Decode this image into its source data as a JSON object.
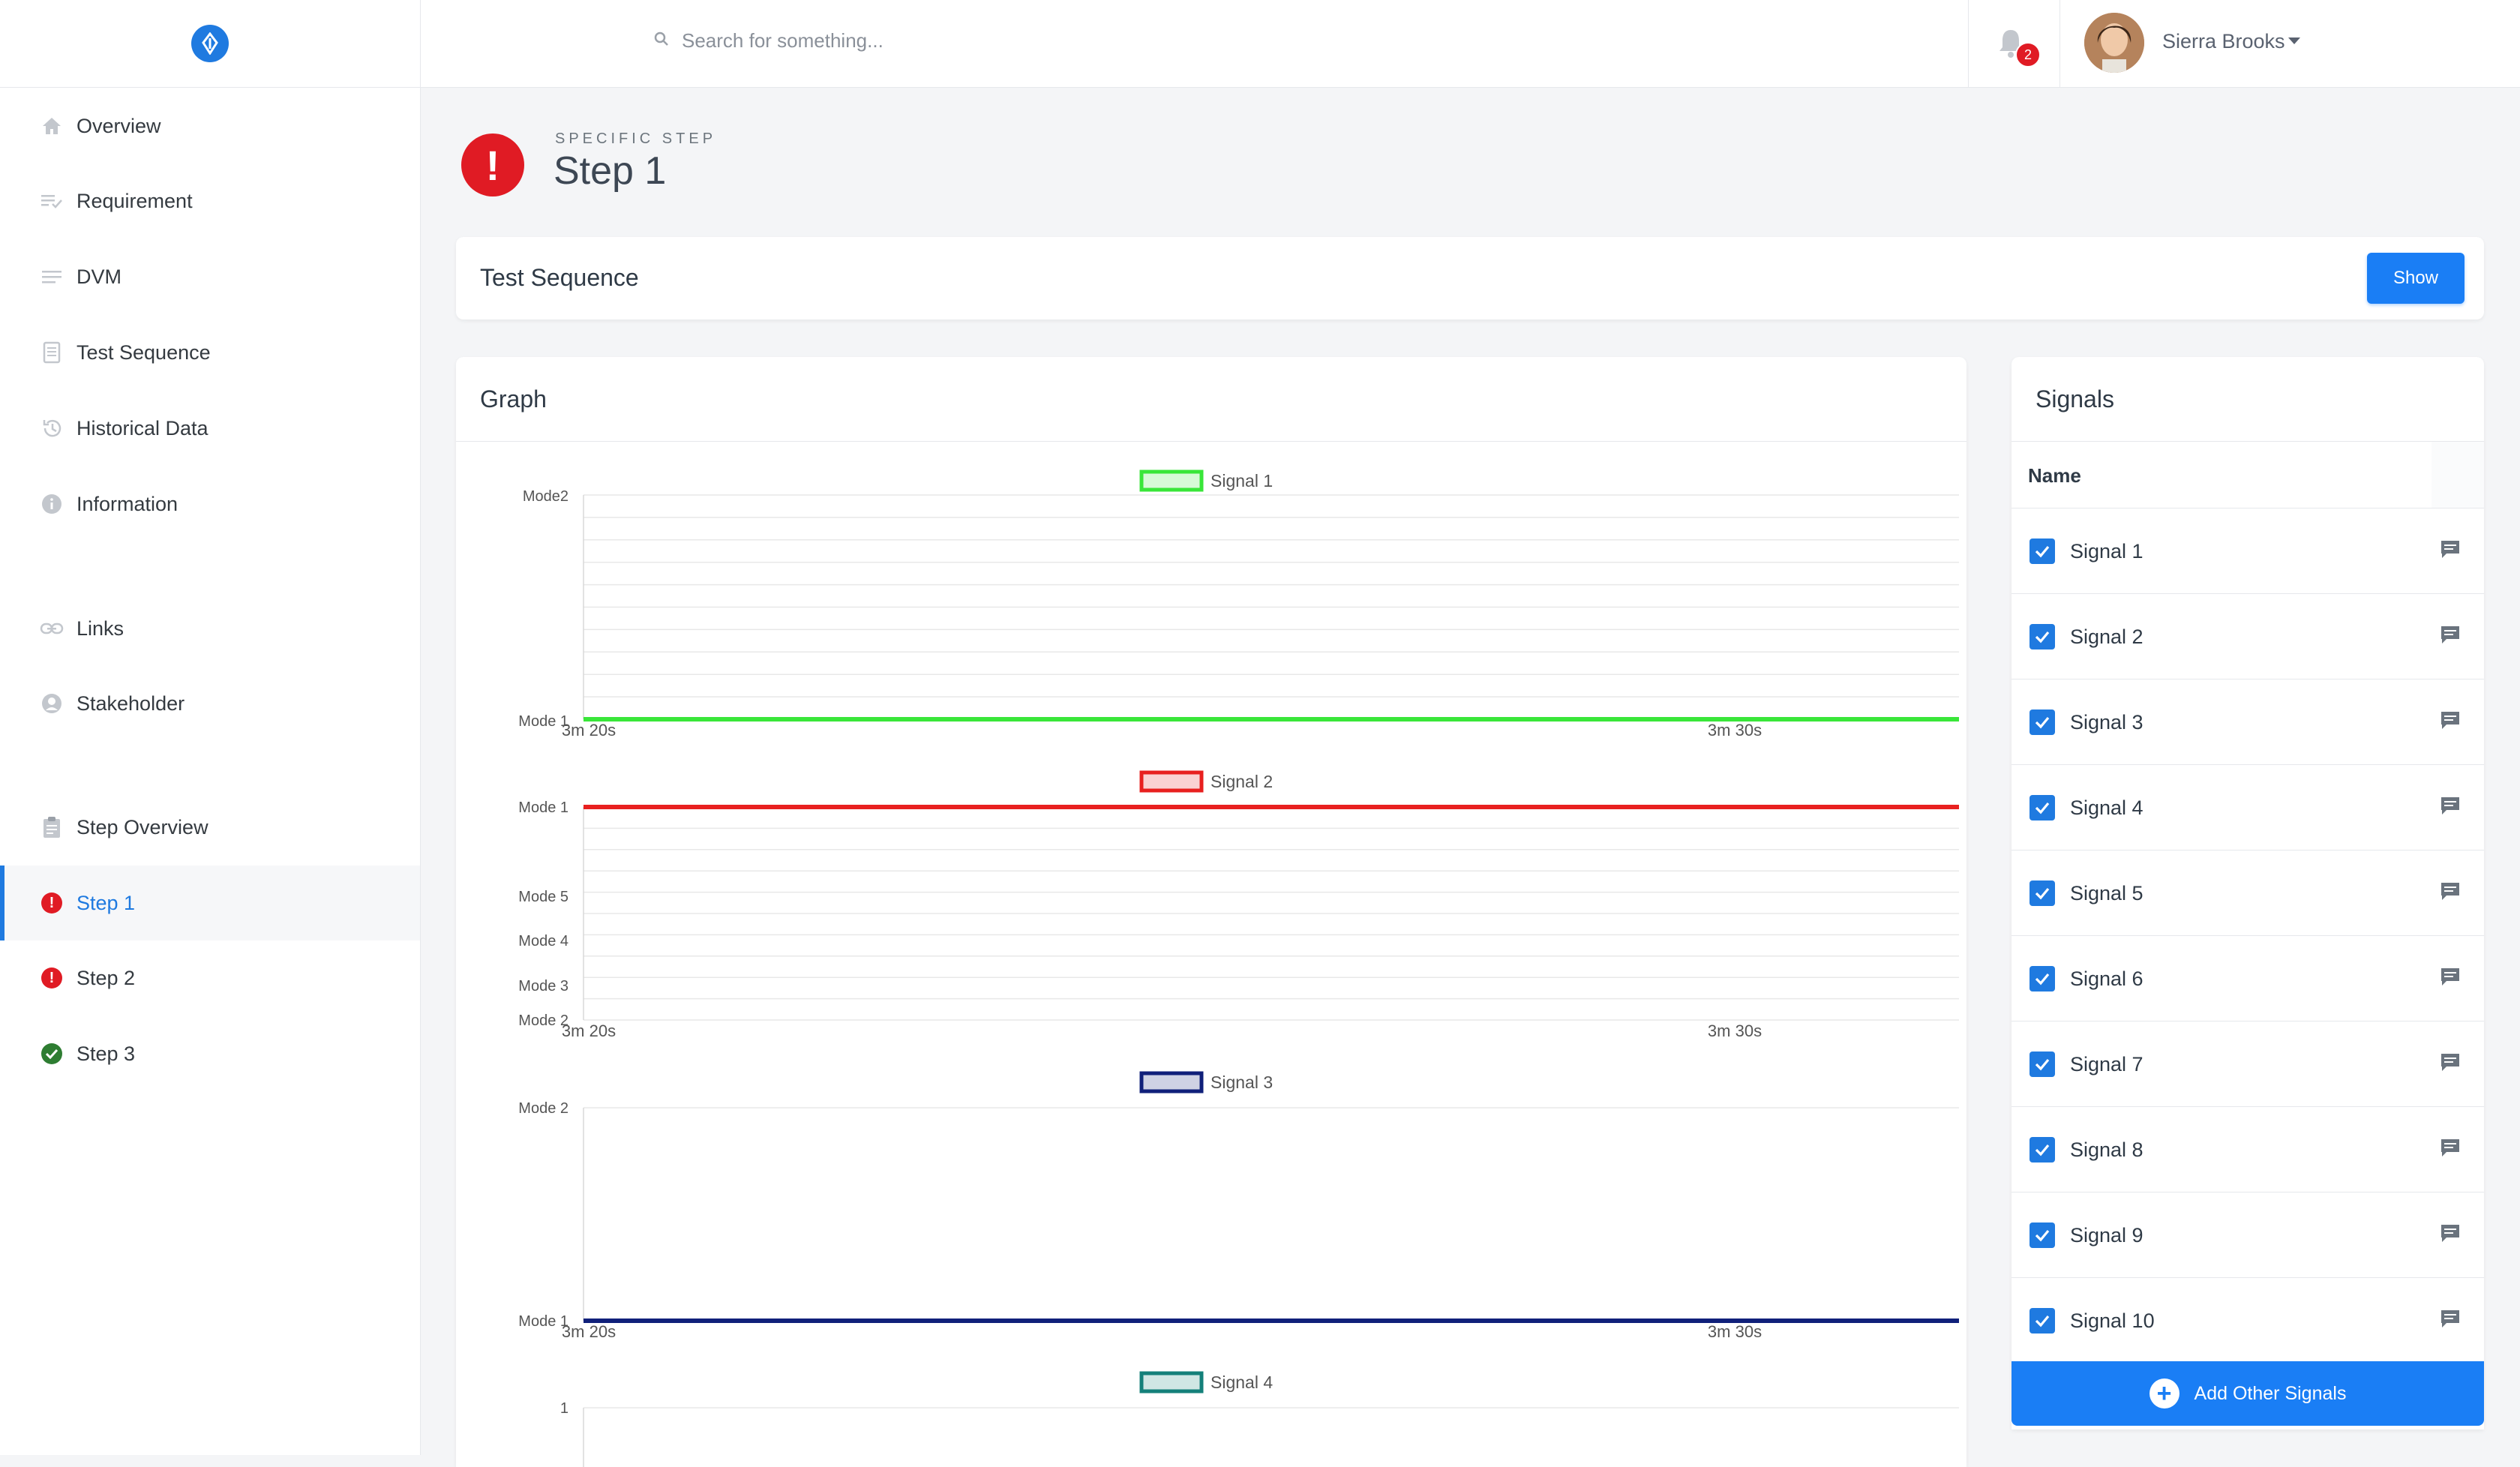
{
  "sidebar": {
    "items": [
      {
        "label": "Overview",
        "icon": "home-icon"
      },
      {
        "label": "Requirement",
        "icon": "list-check-icon"
      },
      {
        "label": "DVM",
        "icon": "lines-icon"
      },
      {
        "label": "Test Sequence",
        "icon": "document-icon"
      },
      {
        "label": "Historical Data",
        "icon": "history-icon"
      },
      {
        "label": "Information",
        "icon": "info-icon"
      },
      {
        "label": "Links",
        "icon": "link-icon"
      },
      {
        "label": "Stakeholder",
        "icon": "user-circle-icon"
      },
      {
        "label": "Step Overview",
        "icon": "clipboard-icon"
      },
      {
        "label": "Step 1",
        "status": "error",
        "active": true
      },
      {
        "label": "Step 2",
        "status": "error"
      },
      {
        "label": "Step 3",
        "status": "ok"
      }
    ]
  },
  "topbar": {
    "search_placeholder": "Search for something...",
    "notification_count": "2",
    "user_name": "Sierra Brooks"
  },
  "page": {
    "subtitle": "SPECIFIC STEP",
    "title": "Step 1",
    "status_mark": "!"
  },
  "test_sequence": {
    "title": "Test Sequence",
    "button": "Show"
  },
  "graph": {
    "title": "Graph"
  },
  "chart_data": [
    {
      "type": "line",
      "legend": "Signal 1",
      "color": "#39e639",
      "y_categories": [
        "Mode1",
        "Mode2"
      ],
      "y_top_label": "Mode2",
      "y_bottom_label": "Mode 1",
      "x_ticks": [
        "3m 20s",
        "3m 30s"
      ],
      "level": "Mode 1"
    },
    {
      "type": "line",
      "legend": "Signal 2",
      "color": "#e8201f",
      "y_labels": [
        "Mode 1",
        "Mode 5",
        "Mode 4",
        "Mode 3",
        "Mode 2"
      ],
      "x_ticks": [
        "3m 20s",
        "3m 30s"
      ],
      "level": "Mode 1"
    },
    {
      "type": "line",
      "legend": "Signal 3",
      "color": "#10207a",
      "y_labels": [
        "Mode 2",
        "Mode 1"
      ],
      "x_ticks": [
        "3m 20s",
        "3m 30s"
      ],
      "level": "Mode 1"
    },
    {
      "type": "line",
      "legend": "Signal 4",
      "color": "#14807a",
      "y_labels": [
        "1"
      ],
      "x_ticks": []
    }
  ],
  "signals": {
    "title": "Signals",
    "column": "Name",
    "items": [
      "Signal 1",
      "Signal 2",
      "Signal 3",
      "Signal 4",
      "Signal 5",
      "Signal 6",
      "Signal 7",
      "Signal 8",
      "Signal 9",
      "Signal 10"
    ],
    "add_button": "Add Other Signals"
  },
  "colors": {
    "accent": "#1f7ae0",
    "error": "#e01b24",
    "ok": "#2e7d32"
  }
}
